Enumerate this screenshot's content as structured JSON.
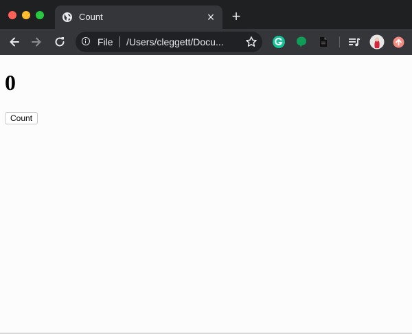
{
  "window": {
    "controls": [
      "close",
      "minimize",
      "maximize"
    ]
  },
  "tab": {
    "title": "Count",
    "favicon": "globe-icon",
    "close_icon": "close-icon",
    "new_tab_icon": "plus-icon"
  },
  "toolbar": {
    "back_icon": "back-arrow-icon",
    "forward_icon": "forward-arrow-icon",
    "reload_icon": "reload-icon",
    "omnibox": {
      "scheme_label": "File",
      "url": "/Users/cleggett/Docu...",
      "info_icon": "info-icon",
      "bookmark_icon": "star-icon"
    },
    "extensions": [
      "grammarly-icon",
      "green-chat-icon",
      "document-icon",
      "media-queue-icon",
      "profile-avatar-icon",
      "update-arrow-icon"
    ]
  },
  "page": {
    "count_value": "0",
    "button_label": "Count"
  },
  "colors": {
    "tabstrip_bg": "#1f2022",
    "toolbar_bg": "#35363a",
    "omnibox_bg": "#202124",
    "page_bg": "#fdfcfd",
    "grammarly_green": "#15c39a",
    "chat_green": "#0f9d58",
    "update_red": "#f28b82"
  }
}
